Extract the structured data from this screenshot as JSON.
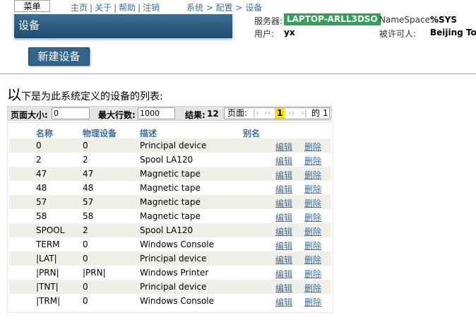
{
  "header": {
    "menu_label": "菜单",
    "links": [
      "主页",
      "关于",
      "帮助",
      "注销"
    ],
    "breadcrumb": "系统 > 配置 > 设备",
    "title": "设备",
    "server_label": "服务器:",
    "server_name": "LAPTOP-ARLL3DSO",
    "namespace_label": "NameSpace:",
    "namespace_value": "%SYS",
    "user_label": "用户:",
    "user_value": "yx",
    "licensee_label": "被许可人:",
    "licensee_value": "Beijing Ton"
  },
  "actions": {
    "new_device": "新建设备"
  },
  "description": {
    "first_char": "以",
    "rest": "下是为此系统定义的设备的列表:"
  },
  "pager": {
    "page_size_label": "页面大小:",
    "page_size_value": "0",
    "max_rows_label": "最大行数:",
    "max_rows_value": "1000",
    "results_label": "结果:",
    "results_value": "12",
    "page_label": "页面:",
    "nav_first": "|‹",
    "nav_prev": "‹‹",
    "current_page": "1",
    "nav_next": "››",
    "nav_last": "›|",
    "of_label": "的",
    "total_pages": "1"
  },
  "table": {
    "columns": [
      "名称",
      "物理设备",
      "描述",
      "别名"
    ],
    "edit_label": "编辑",
    "delete_label": "删除",
    "rows": [
      {
        "name": "0",
        "physical": "0",
        "desc": "Principal device"
      },
      {
        "name": "2",
        "physical": "2",
        "desc": "Spool LA120"
      },
      {
        "name": "47",
        "physical": "47",
        "desc": "Magnetic tape"
      },
      {
        "name": "48",
        "physical": "48",
        "desc": "Magnetic tape"
      },
      {
        "name": "57",
        "physical": "57",
        "desc": "Magnetic tape"
      },
      {
        "name": "58",
        "physical": "58",
        "desc": "Magnetic tape"
      },
      {
        "name": "SPOOL",
        "physical": "2",
        "desc": "Spool LA120"
      },
      {
        "name": "TERM",
        "physical": "0",
        "desc": "Windows Console"
      },
      {
        "name": "|LAT|",
        "physical": "0",
        "desc": "Principal device"
      },
      {
        "name": "|PRN|",
        "physical": "|PRN|",
        "desc": "Windows Printer"
      },
      {
        "name": "|TNT|",
        "physical": "0",
        "desc": "Principal device"
      },
      {
        "name": "|TRM|",
        "physical": "0",
        "desc": "Windows Console"
      }
    ]
  }
}
